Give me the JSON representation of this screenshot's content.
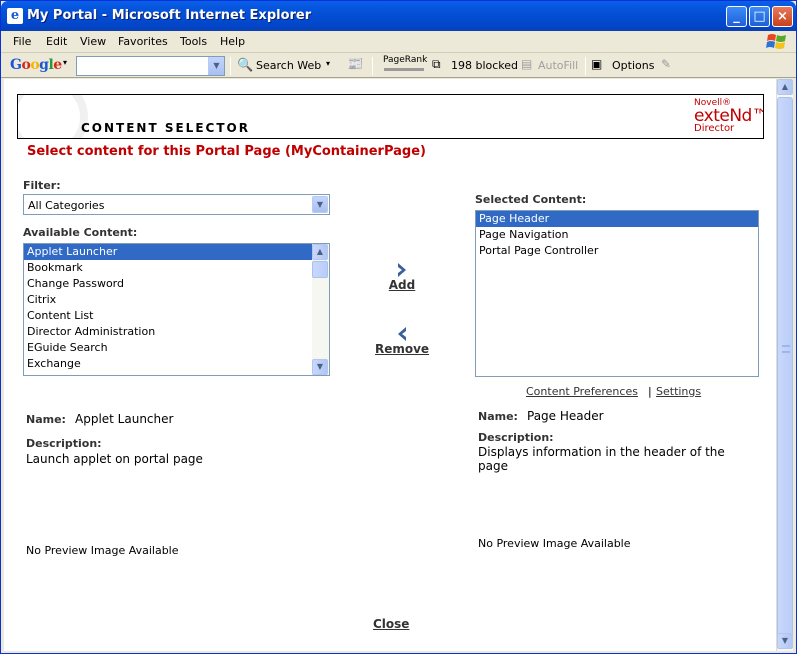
{
  "window": {
    "title": "My Portal - Microsoft Internet Explorer",
    "minimize": "_",
    "maximize": "□",
    "close": "×"
  },
  "menu": [
    "File",
    "Edit",
    "View",
    "Favorites",
    "Tools",
    "Help"
  ],
  "toolbar": {
    "google": "Google",
    "search_web": "Search Web",
    "pagerank": "PageRank",
    "blocked": "198 blocked",
    "autofill": "AutoFill",
    "options": "Options"
  },
  "banner": {
    "title": "CONTENT SELECTOR",
    "brand_small": "Novell®",
    "brand_big": "exteNd™",
    "brand_sub": "Director"
  },
  "heading": "Select content for this Portal Page (MyContainerPage)",
  "filter": {
    "label": "Filter:",
    "value": "All Categories"
  },
  "available": {
    "label": "Available Content:",
    "items": [
      "Applet Launcher",
      "Bookmark",
      "Change Password",
      "Citrix",
      "Content List",
      "Director Administration",
      "EGuide Search",
      "Exchange"
    ],
    "selected_index": 0
  },
  "selected": {
    "label": "Selected Content:",
    "items": [
      "Page Header",
      "Page Navigation",
      "Portal Page Controller"
    ],
    "selected_index": 0
  },
  "actions": {
    "add": "Add",
    "remove": "Remove"
  },
  "links": {
    "content_preferences": "Content Preferences",
    "separator": "|",
    "settings": "Settings"
  },
  "left_detail": {
    "name_label": "Name:",
    "name": "Applet Launcher",
    "desc_label": "Description:",
    "desc": "Launch applet on portal page",
    "preview": "No Preview Image Available"
  },
  "right_detail": {
    "name_label": "Name:",
    "name": "Page Header",
    "desc_label": "Description:",
    "desc_line1": "Displays information in the header of the",
    "desc_line2": "page",
    "preview": "No Preview Image Available"
  },
  "close": "Close",
  "colors": {
    "heading": "#c00000",
    "selection": "#316ac5",
    "titlebar": "#0450d6"
  }
}
